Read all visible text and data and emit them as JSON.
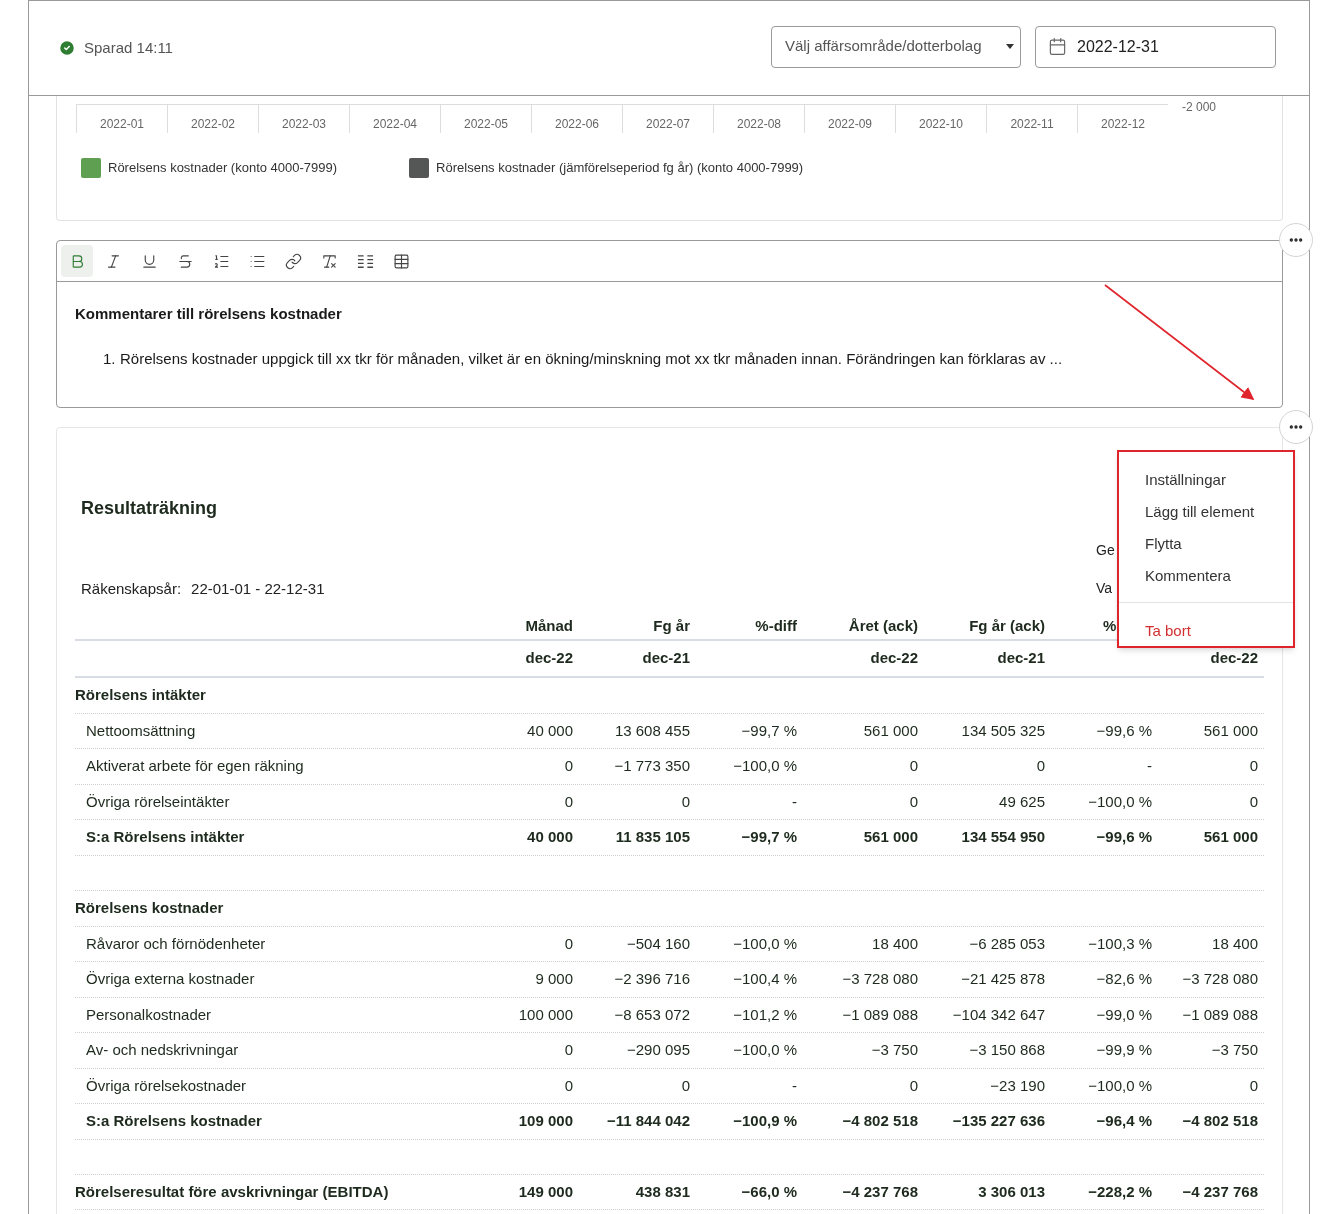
{
  "header": {
    "status": "Sparad 14:11",
    "select": {
      "placeholder": "Välj affärsområde/dotterbolag"
    },
    "date": {
      "value": "2022-12-31"
    }
  },
  "chart": {
    "x_labels": [
      "2022-01",
      "2022-02",
      "2022-03",
      "2022-04",
      "2022-05",
      "2022-06",
      "2022-07",
      "2022-08",
      "2022-09",
      "2022-10",
      "2022-11",
      "2022-12"
    ],
    "y_tick": "-2 000",
    "legend": [
      {
        "label": "Rörelsens kostnader (konto 4000-7999)",
        "color": "#5f9f52"
      },
      {
        "label": "Rörelsens kostnader (jämförelseperiod fg år) (konto 4000-7999)",
        "color": "#555757"
      }
    ]
  },
  "editor": {
    "toolbar": [
      {
        "kind": "bold",
        "selected": true
      },
      {
        "kind": "italic",
        "selected": false
      },
      {
        "kind": "underline",
        "selected": false
      },
      {
        "kind": "strike",
        "selected": false
      },
      {
        "kind": "ordered",
        "selected": false
      },
      {
        "kind": "bullets",
        "selected": false
      },
      {
        "kind": "link",
        "selected": false
      },
      {
        "kind": "clear",
        "selected": false
      },
      {
        "kind": "columns",
        "selected": false
      },
      {
        "kind": "table",
        "selected": false
      }
    ],
    "heading": "Kommentarer till rörelsens kostnader",
    "items": [
      {
        "number": "1.",
        "text": "Rörelsens kostnader uppgick till xx tkr för månaden, vilket är en ökning/minskning mot xx tkr månaden innan. Förändringen kan förklaras av ..."
      }
    ]
  },
  "report": {
    "title": "Resultaträkning",
    "fiscal_year_label": "Räkenskapsår:",
    "fiscal_year": "22-01-01 - 22-12-31",
    "side_texts": [
      "Ge",
      "Va"
    ],
    "columns": [
      "Månad",
      "Fg år",
      "%-diff",
      "Året (ack)",
      "Fg år (ack)",
      "%"
    ],
    "periods": [
      {
        "kind": "date",
        "label": "dec-22"
      },
      {
        "kind": "date",
        "label": "dec-21"
      },
      {
        "kind": "blank"
      },
      {
        "kind": "date",
        "label": "dec-22"
      },
      {
        "kind": "date",
        "label": "dec-21"
      },
      {
        "kind": "blank"
      },
      {
        "kind": "date",
        "label": "dec-22"
      }
    ],
    "rows": [
      {
        "kind": "section",
        "label": "Rörelsens intäkter"
      },
      {
        "kind": "item",
        "label": "Nettoomsättning",
        "values": [
          "40 000",
          "13 608 455",
          "−99,7 %",
          "561 000",
          "134 505 325",
          "−99,6 %",
          "561 000"
        ]
      },
      {
        "kind": "item",
        "label": "Aktiverat arbete för egen räkning",
        "values": [
          "0",
          "−1 773 350",
          "−100,0 %",
          "0",
          "0",
          "-",
          "0"
        ]
      },
      {
        "kind": "item",
        "label": "Övriga rörelseintäkter",
        "values": [
          "0",
          "0",
          "-",
          "0",
          "49 625",
          "−100,0 %",
          "0"
        ]
      },
      {
        "kind": "total",
        "label": "S:a Rörelsens intäkter",
        "values": [
          "40 000",
          "11 835 105",
          "−99,7 %",
          "561 000",
          "134 554 950",
          "−99,6 %",
          "561 000"
        ]
      },
      {
        "kind": "spacer"
      },
      {
        "kind": "section",
        "label": "Rörelsens kostnader"
      },
      {
        "kind": "item",
        "label": "Råvaror och förnödenheter",
        "values": [
          "0",
          "−504 160",
          "−100,0 %",
          "18 400",
          "−6 285 053",
          "−100,3 %",
          "18 400"
        ]
      },
      {
        "kind": "item",
        "label": "Övriga externa kostnader",
        "values": [
          "9 000",
          "−2 396 716",
          "−100,4 %",
          "−3 728 080",
          "−21 425 878",
          "−82,6 %",
          "−3 728 080"
        ]
      },
      {
        "kind": "item",
        "label": "Personalkostnader",
        "values": [
          "100 000",
          "−8 653 072",
          "−101,2 %",
          "−1 089 088",
          "−104 342 647",
          "−99,0 %",
          "−1 089 088"
        ]
      },
      {
        "kind": "item",
        "label": "Av- och nedskrivningar",
        "values": [
          "0",
          "−290 095",
          "−100,0 %",
          "−3 750",
          "−3 150 868",
          "−99,9 %",
          "−3 750"
        ]
      },
      {
        "kind": "item",
        "label": "Övriga rörelsekostnader",
        "values": [
          "0",
          "0",
          "-",
          "0",
          "−23 190",
          "−100,0 %",
          "0"
        ]
      },
      {
        "kind": "total",
        "label": "S:a Rörelsens kostnader",
        "values": [
          "109 000",
          "−11 844 042",
          "−100,9 %",
          "−4 802 518",
          "−135 227 636",
          "−96,4 %",
          "−4 802 518"
        ]
      },
      {
        "kind": "spacer"
      },
      {
        "kind": "total",
        "label": "Rörelseresultat före avskrivningar (EBITDA)",
        "flush": true,
        "values": [
          "149 000",
          "438 831",
          "−66,0 %",
          "−4 237 768",
          "3 306 013",
          "−228,2 %",
          "−4 237 768"
        ]
      }
    ]
  },
  "menu": {
    "items": [
      {
        "label": "Inställningar",
        "kind": "normal"
      },
      {
        "label": "Lägg till element",
        "kind": "normal"
      },
      {
        "label": "Flytta",
        "kind": "normal"
      },
      {
        "label": "Kommentera",
        "kind": "normal"
      },
      {
        "label": "Ta bort",
        "kind": "danger"
      }
    ]
  }
}
